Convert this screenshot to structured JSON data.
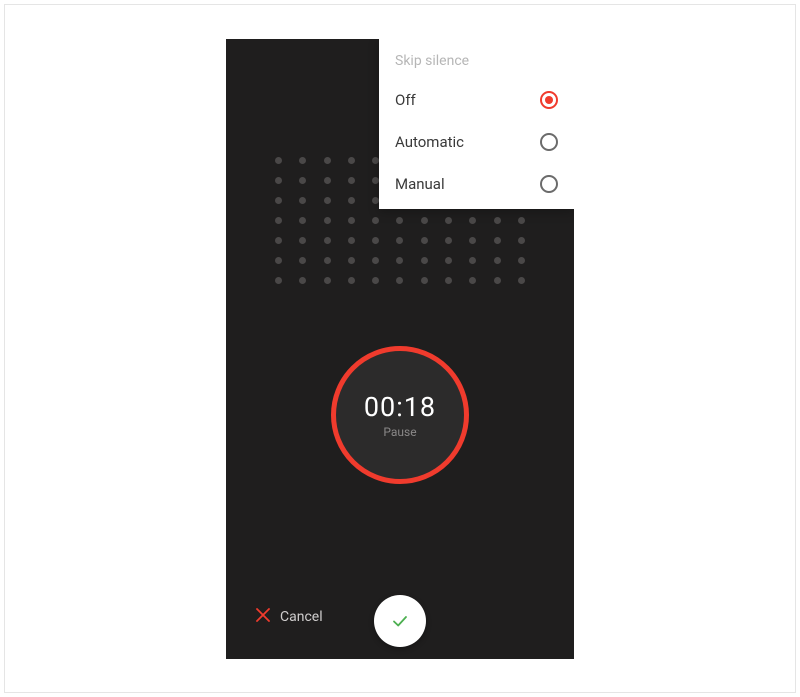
{
  "menu": {
    "title": "Skip silence",
    "items": [
      {
        "label": "Off",
        "selected": true
      },
      {
        "label": "Automatic",
        "selected": false
      },
      {
        "label": "Manual",
        "selected": false
      }
    ]
  },
  "recorder": {
    "timer": "00:18",
    "pause_label": "Pause"
  },
  "bottom": {
    "cancel_label": "Cancel"
  },
  "colors": {
    "accent": "#f03b2d",
    "confirm": "#4caf50"
  }
}
